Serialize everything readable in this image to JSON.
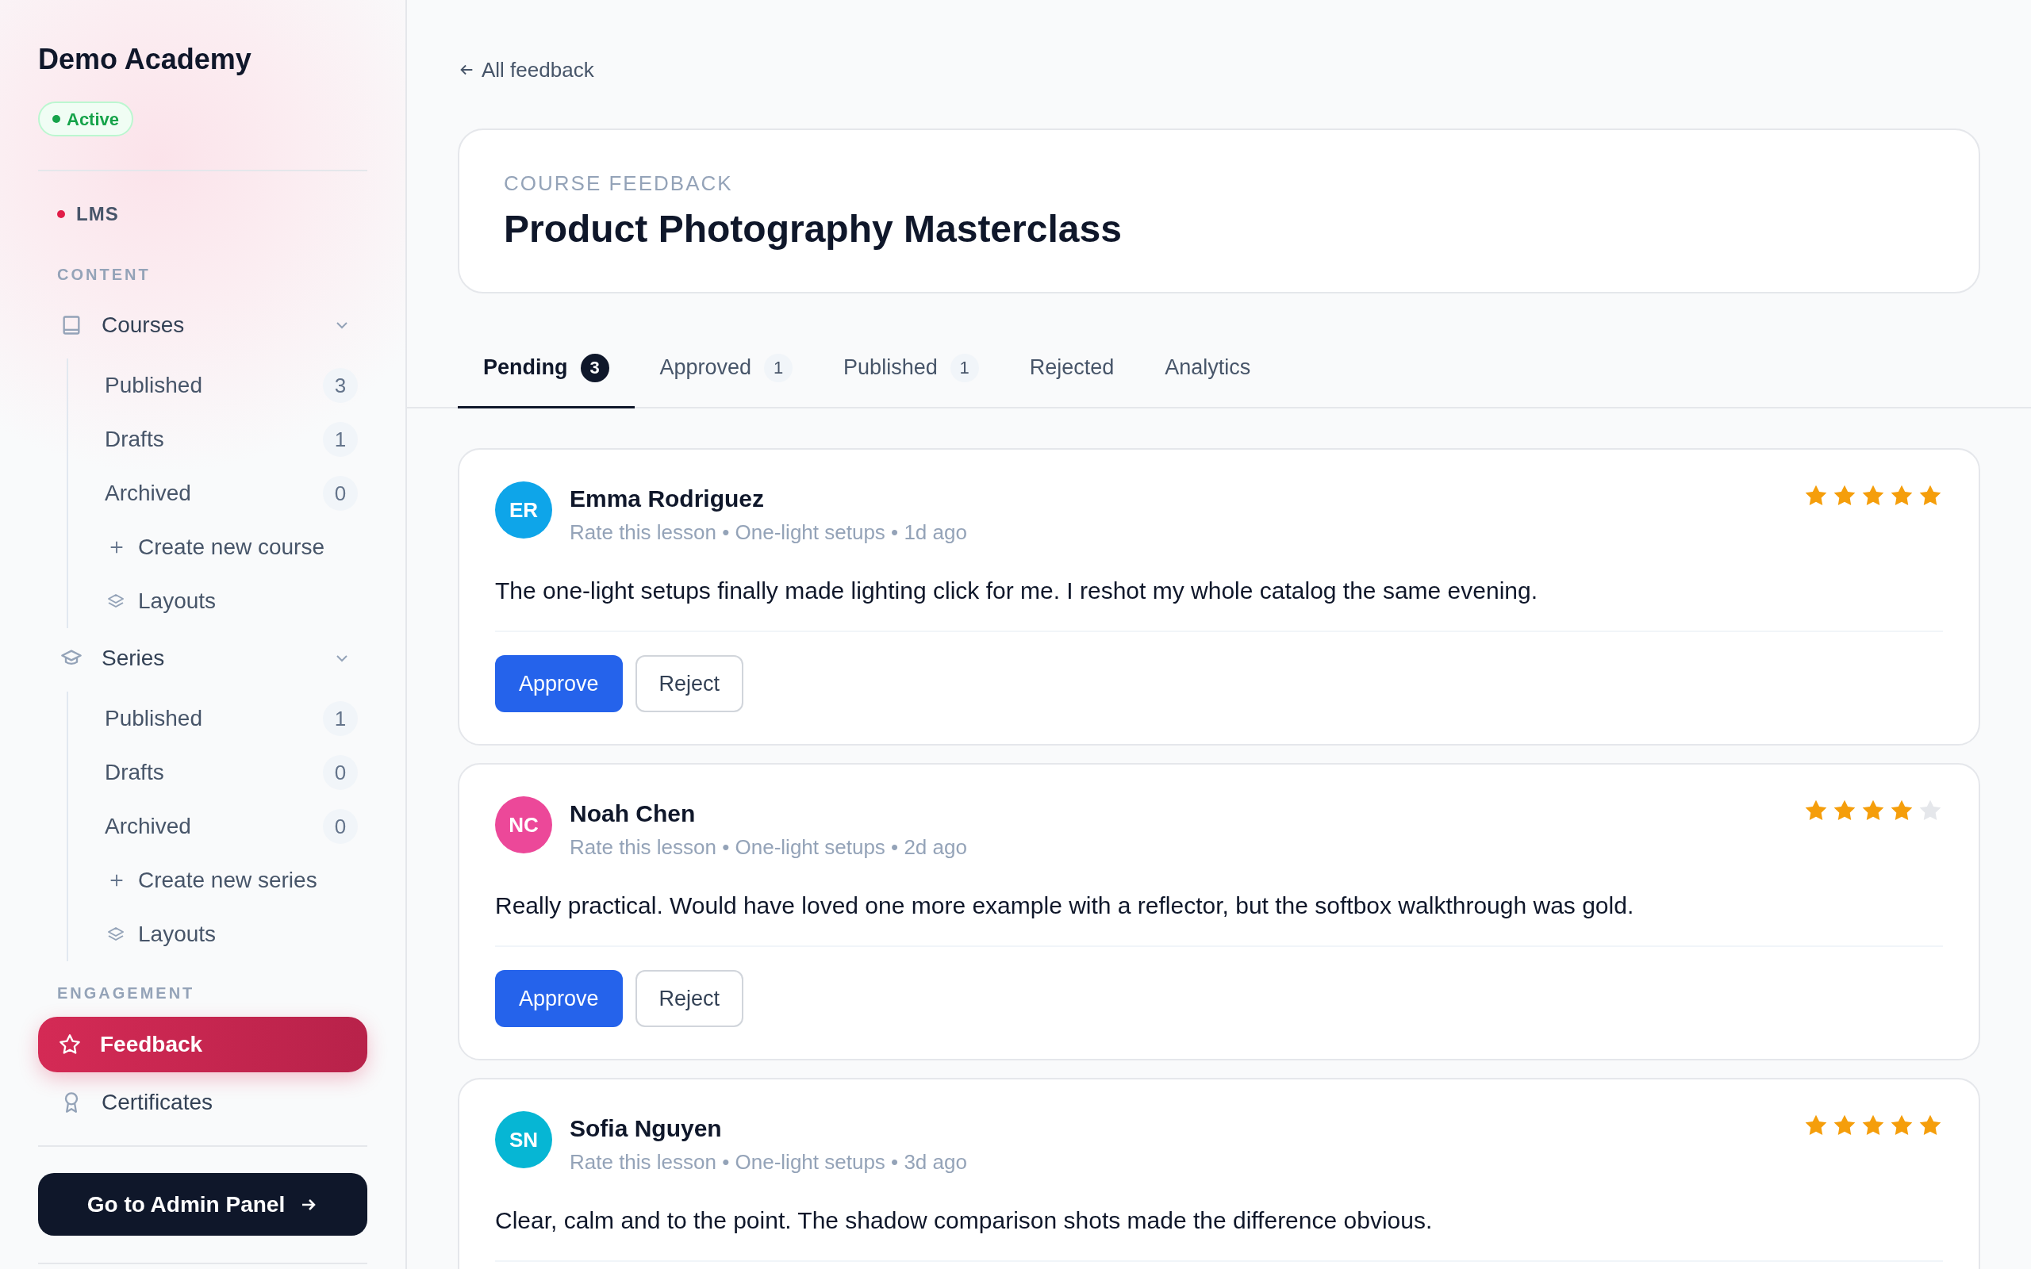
{
  "sidebar": {
    "title": "Demo Academy",
    "status": "Active",
    "app": "LMS",
    "sections": [
      {
        "heading": "CONTENT",
        "items": [
          {
            "label": "Courses",
            "selected": false,
            "expanded": true,
            "children": [
              {
                "kind": "count",
                "label": "Published",
                "count": "3"
              },
              {
                "kind": "count",
                "label": "Drafts",
                "count": "1"
              },
              {
                "kind": "count",
                "label": "Archived",
                "count": "0"
              },
              {
                "kind": "create",
                "label": "Create new course"
              },
              {
                "kind": "layouts",
                "label": "Layouts"
              }
            ]
          },
          {
            "label": "Series",
            "selected": false,
            "expanded": true,
            "children": [
              {
                "kind": "count",
                "label": "Published",
                "count": "1"
              },
              {
                "kind": "count",
                "label": "Drafts",
                "count": "0"
              },
              {
                "kind": "count",
                "label": "Archived",
                "count": "0"
              },
              {
                "kind": "create",
                "label": "Create new series"
              },
              {
                "kind": "layouts",
                "label": "Layouts"
              }
            ]
          }
        ]
      },
      {
        "heading": "ENGAGEMENT",
        "items": [
          {
            "label": "Feedback",
            "selected": true
          },
          {
            "label": "Certificates",
            "selected": false
          }
        ]
      }
    ],
    "admin_button": "Go to Admin Panel"
  },
  "back_link": "All feedback",
  "header": {
    "eyebrow": "COURSE FEEDBACK",
    "title": "Product Photography Masterclass"
  },
  "tabs": [
    {
      "label": "Pending",
      "count": "3",
      "selected": true
    },
    {
      "label": "Approved",
      "count": "1",
      "selected": false
    },
    {
      "label": "Published",
      "count": "1",
      "selected": false
    },
    {
      "label": "Rejected",
      "selected": false
    },
    {
      "label": "Analytics",
      "selected": false
    }
  ],
  "reviews": [
    {
      "initials": "ER",
      "color": "#0ea5e9",
      "name": "Emma Rodriguez",
      "meta": "Rate this lesson • One-light setups • 1d ago",
      "stars": 5,
      "text": "The one-light setups finally made lighting click for me. I reshot my whole catalog the same evening.",
      "actions": [
        {
          "kind": "primary",
          "label": "Approve"
        },
        {
          "kind": "secondary",
          "label": "Reject"
        }
      ]
    },
    {
      "initials": "NC",
      "color": "#ec4899",
      "name": "Noah Chen",
      "meta": "Rate this lesson • One-light setups • 2d ago",
      "stars": 4,
      "text": "Really practical. Would have loved one more example with a reflector, but the softbox walkthrough was gold.",
      "actions": [
        {
          "kind": "primary",
          "label": "Approve"
        },
        {
          "kind": "secondary",
          "label": "Reject"
        }
      ]
    },
    {
      "initials": "SN",
      "color": "#06b6d4",
      "name": "Sofia Nguyen",
      "meta": "Rate this lesson • One-light setups • 3d ago",
      "stars": 5,
      "text": "Clear, calm and to the point. The shadow comparison shots made the difference obvious."
    }
  ]
}
